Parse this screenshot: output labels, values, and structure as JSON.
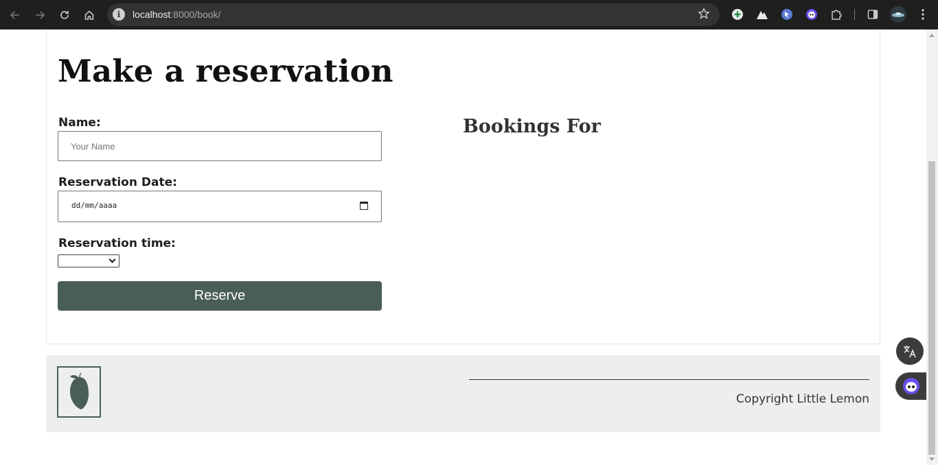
{
  "browser": {
    "url_host": "localhost",
    "url_path": ":8000/book/",
    "back_icon": "arrow-left-icon",
    "forward_icon": "arrow-right-icon",
    "reload_icon": "reload-icon",
    "home_icon": "home-icon",
    "info_icon": "info-icon",
    "info_glyph": "i",
    "bookmark_icon": "star-icon",
    "extensions": [
      "plus-circle-icon",
      "mountain-icon",
      "cursor-icon",
      "bot-icon",
      "puzzle-icon"
    ],
    "side_panel_icon": "side-panel-icon",
    "menu_icon": "kebab-menu-icon"
  },
  "page": {
    "title": "Make a reservation",
    "form": {
      "name_label": "Name:",
      "name_placeholder": "Your Name",
      "date_label": "Reservation Date:",
      "date_placeholder": "dd/mm/aaaa",
      "time_label": "Reservation time:",
      "time_selected": "",
      "submit_label": "Reserve"
    },
    "bookings_title": "Bookings For"
  },
  "footer": {
    "logo_icon": "lemon-icon",
    "copyright": "Copyright Little Lemon"
  },
  "colors": {
    "brand_green": "#495e57",
    "footer_bg": "#edefee"
  }
}
